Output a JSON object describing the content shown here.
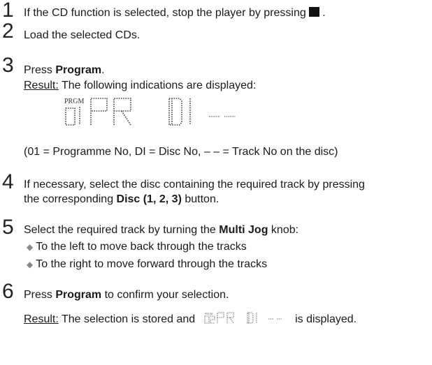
{
  "steps": [
    {
      "n": "1",
      "text_a": "If the CD function is selected, stop the player by pressing",
      "text_b": "."
    },
    {
      "n": "2",
      "text": "Load the selected CDs."
    },
    {
      "n": "3",
      "text_a": "Press ",
      "bold": "Program",
      "text_b": ".",
      "result_label": "Result:",
      "result_text": " The following indications are displayed:",
      "display": {
        "prgm": "PRGM",
        "prog_no": "01",
        "pr": "PR",
        "disc": "DI"
      },
      "legend": "(01 = Programme No, DI = Disc No, – – = Track No on the disc)"
    },
    {
      "n": "4",
      "line1": "If necessary, select the disc containing the required track by pressing",
      "line2_a": "the corresponding ",
      "line2_bold": "Disc (1, 2, 3)",
      "line2_b": " button."
    },
    {
      "n": "5",
      "text_a": "Select the required track by turning the ",
      "bold": "Multi Jog",
      "text_b": " knob:",
      "bullets": [
        "To the left to move back through the tracks",
        "To the right to move forward through the tracks"
      ]
    },
    {
      "n": "6",
      "text_a": "Press ",
      "bold": "Program",
      "text_b": " to confirm your selection.",
      "result_label": "Result:",
      "result_text_a": " The selection is stored and ",
      "result_text_b": " is displayed.",
      "display": {
        "prgm": "PRGM",
        "prog_no": "02",
        "pr": "PR",
        "disc": "DI"
      }
    }
  ],
  "icons": {
    "stop": "stop-square-icon",
    "bullet": "diamond-bullet-icon"
  }
}
